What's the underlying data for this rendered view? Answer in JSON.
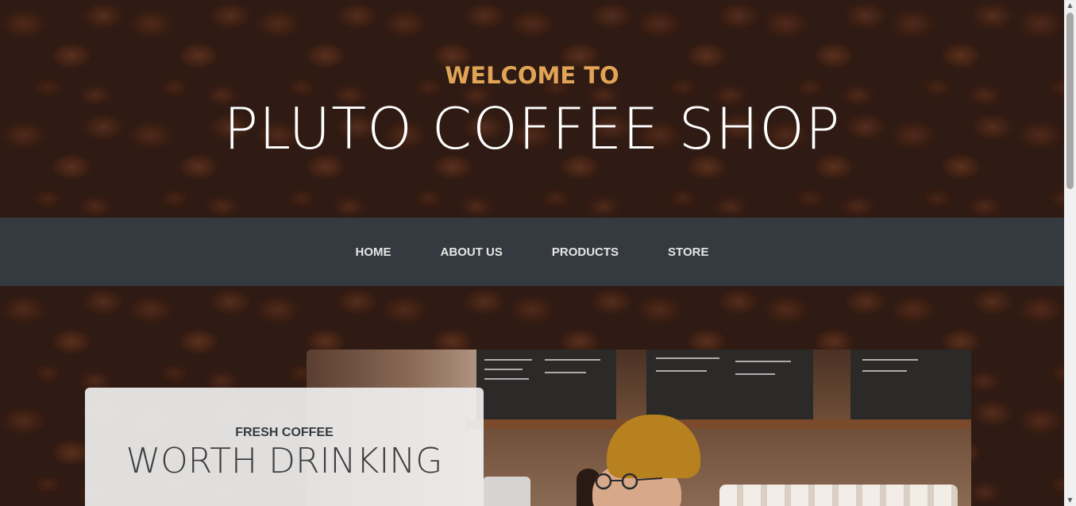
{
  "header": {
    "welcome": "WELCOME TO",
    "title": "PLUTO COFFEE SHOP"
  },
  "nav": {
    "items": [
      {
        "label": "HOME"
      },
      {
        "label": "ABOUT US"
      },
      {
        "label": "PRODUCTS"
      },
      {
        "label": "STORE"
      }
    ]
  },
  "intro": {
    "subheading": "FRESH COFFEE",
    "heading": "WORTH DRINKING"
  },
  "colors": {
    "accent": "#e1a456",
    "navbar": "#343a40",
    "nav_text": "#e6e6e6",
    "card_bg": "#f0f0f0"
  },
  "scrollbar": {
    "up_icon": "scroll-up-arrow-icon",
    "down_icon": "scroll-down-arrow-icon"
  }
}
